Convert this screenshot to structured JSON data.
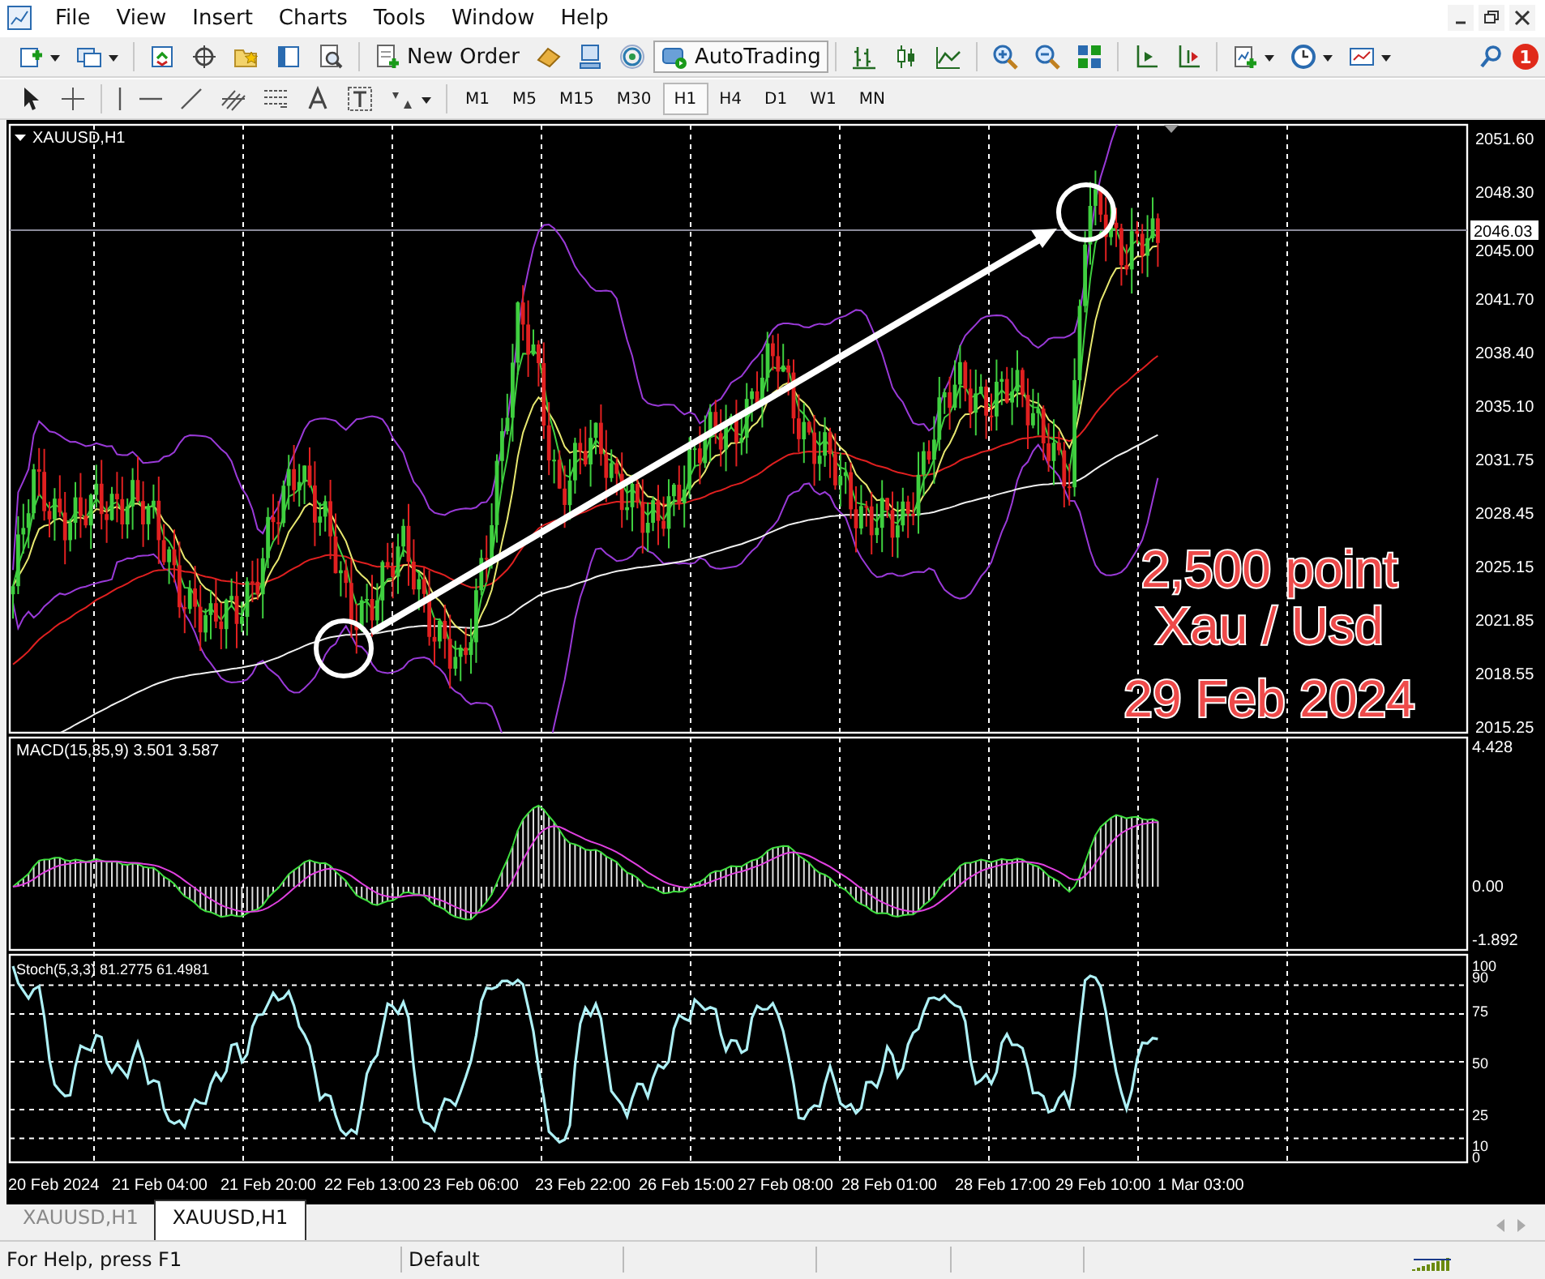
{
  "menu": [
    {
      "label": "File"
    },
    {
      "label": "View"
    },
    {
      "label": "Insert"
    },
    {
      "label": "Charts"
    },
    {
      "label": "Tools"
    },
    {
      "label": "Window"
    },
    {
      "label": "Help"
    }
  ],
  "toolbar": {
    "new_order": "New Order",
    "autotrading": "AutoTrading",
    "notification_count": "1"
  },
  "timeframes": [
    {
      "label": "M1",
      "selected": false
    },
    {
      "label": "M5",
      "selected": false
    },
    {
      "label": "M15",
      "selected": false
    },
    {
      "label": "M30",
      "selected": false
    },
    {
      "label": "H1",
      "selected": true
    },
    {
      "label": "H4",
      "selected": false
    },
    {
      "label": "D1",
      "selected": false
    },
    {
      "label": "W1",
      "selected": false
    },
    {
      "label": "MN",
      "selected": false
    }
  ],
  "chart": {
    "symbol": "XAUUSD,H1",
    "price_labels": [
      "2051.60",
      "2048.30",
      "2045.00",
      "2041.70",
      "2038.40",
      "2035.10",
      "2031.75",
      "2028.45",
      "2025.15",
      "2021.85",
      "2018.55",
      "2015.25"
    ],
    "current_price": "2046.03",
    "annotation": [
      "2,500 point",
      "Xau / Usd",
      "29 Feb 2024"
    ],
    "macd": {
      "label": "MACD(15,35,9) 3.501 3.587",
      "scale": [
        "4.428",
        "0.00",
        "-1.892"
      ]
    },
    "stochastic": {
      "label": "Stoch(5,3,3) 81.2775 61.4981",
      "scale": [
        "100",
        "90",
        "75",
        "50",
        "25",
        "10",
        "0"
      ]
    },
    "time_labels": [
      "20 Feb 2024",
      "21 Feb 04:00",
      "21 Feb 20:00",
      "22 Feb 13:00",
      "23 Feb 06:00",
      "23 Feb 22:00",
      "26 Feb 15:00",
      "27 Feb 08:00",
      "28 Feb 01:00",
      "28 Feb 17:00",
      "29 Feb 10:00",
      "1 Mar 03:00"
    ]
  },
  "chart_tabs": [
    {
      "label": "XAUUSD,H1",
      "selected": false
    },
    {
      "label": "XAUUSD,H1",
      "selected": true
    }
  ],
  "status_bar": {
    "help": "For Help, press F1",
    "profile": "Default"
  }
}
